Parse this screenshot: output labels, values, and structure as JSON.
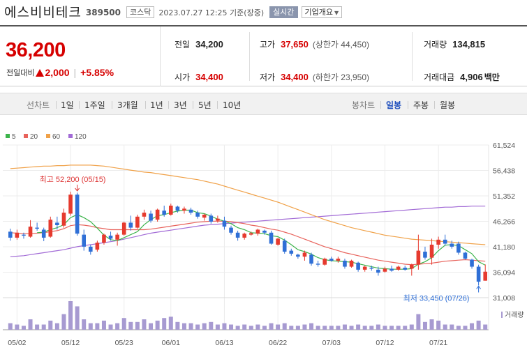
{
  "header": {
    "stock_name": "에스비비테크",
    "stock_code": "389500",
    "market": "코스닥",
    "timestamp": "2023.07.27 12:25 기준(장중)",
    "realtime_label": "실시간",
    "overview_label": "기업개요"
  },
  "summary": {
    "current_price": "36,200",
    "change_label": "전일대비",
    "change_amount": "2,000",
    "change_percent": "+5.85%",
    "prev_close_label": "전일",
    "prev_close": "34,200",
    "open_label": "시가",
    "open": "34,400",
    "high_label": "고가",
    "high": "37,650",
    "upper_limit": "(상한가 44,450)",
    "low_label": "저가",
    "low": "34,400",
    "lower_limit": "(하한가 23,950)",
    "volume_label": "거래량",
    "volume": "134,815",
    "amount_label": "거래대금",
    "amount": "4,906",
    "amount_unit": "백만"
  },
  "period_bar": {
    "label": "선차트",
    "periods": [
      "1일",
      "1주일",
      "3개월",
      "1년",
      "3년",
      "5년",
      "10년"
    ],
    "candle_label": "봉차트",
    "candles": [
      "일봉",
      "주봉",
      "월봉"
    ],
    "active_candle": "일봉"
  },
  "colors": {
    "up": "#e63a2e",
    "down": "#2f6fd6",
    "accent": "#1f4fbd",
    "volume": "#a79ad1"
  },
  "chart_data": {
    "type": "candlestick",
    "legend": [
      {
        "name": "5",
        "color": "#3cb44b"
      },
      {
        "name": "20",
        "color": "#e8625b"
      },
      {
        "name": "60",
        "color": "#f0a148"
      },
      {
        "name": "120",
        "color": "#a26bd6"
      }
    ],
    "y_ticks": [
      "61,524",
      "56,438",
      "51,352",
      "46,266",
      "41,180",
      "36,094",
      "31,008"
    ],
    "ylim": [
      31008,
      61524
    ],
    "x_ticks": [
      "05/02",
      "05/12",
      "05/23",
      "06/01",
      "06/13",
      "06/22",
      "07/03",
      "07/12",
      "07/21"
    ],
    "x_tick_index": [
      1,
      9,
      17,
      24,
      32,
      40,
      48,
      56,
      64
    ],
    "volume_label": "거래량",
    "annotations": {
      "max": {
        "text": "최고 52,200 (05/15)",
        "index": 10,
        "value": 52200
      },
      "min": {
        "text": "최저 33,450 (07/26)",
        "index": 70,
        "value": 33450
      }
    },
    "candles": [
      [
        44200,
        44800,
        42400,
        43000
      ],
      [
        43000,
        44600,
        42600,
        44000
      ],
      [
        43600,
        44000,
        42800,
        43400
      ],
      [
        43200,
        46500,
        43000,
        45200
      ],
      [
        45000,
        46000,
        44400,
        44800
      ],
      [
        44600,
        45000,
        42300,
        43000
      ],
      [
        43200,
        47200,
        43000,
        46600
      ],
      [
        46000,
        47200,
        44600,
        45500
      ],
      [
        45400,
        48800,
        45000,
        48000
      ],
      [
        47800,
        52200,
        47400,
        51600
      ],
      [
        51600,
        52000,
        43400,
        43800
      ],
      [
        43600,
        44600,
        40400,
        41200
      ],
      [
        41200,
        41600,
        39600,
        40200
      ],
      [
        40600,
        42400,
        40200,
        42000
      ],
      [
        42000,
        43800,
        41600,
        43600
      ],
      [
        43400,
        44200,
        42400,
        42800
      ],
      [
        42600,
        44000,
        41400,
        43600
      ],
      [
        43600,
        46200,
        43400,
        46000
      ],
      [
        46000,
        47400,
        44400,
        45000
      ],
      [
        45000,
        47600,
        44800,
        47200
      ],
      [
        47200,
        48600,
        46600,
        48000
      ],
      [
        47800,
        48400,
        46000,
        46400
      ],
      [
        46600,
        48800,
        46200,
        48600
      ],
      [
        48400,
        49400,
        47200,
        47600
      ],
      [
        47600,
        49800,
        47400,
        49400
      ],
      [
        49200,
        49400,
        48000,
        48400
      ],
      [
        48400,
        49200,
        47800,
        48800
      ],
      [
        48600,
        49000,
        47600,
        48000
      ],
      [
        48000,
        48400,
        46800,
        47200
      ],
      [
        47000,
        47800,
        46400,
        47600
      ],
      [
        47400,
        47800,
        45800,
        46200
      ],
      [
        46400,
        47400,
        46000,
        46800
      ],
      [
        46400,
        47200,
        44600,
        45200
      ],
      [
        45000,
        45400,
        43600,
        44000
      ],
      [
        44000,
        44400,
        42400,
        43000
      ],
      [
        43000,
        44000,
        42600,
        43800
      ],
      [
        43600,
        44200,
        43400,
        43900
      ],
      [
        43800,
        44800,
        43400,
        44600
      ],
      [
        44400,
        44600,
        43600,
        44000
      ],
      [
        44000,
        44400,
        41600,
        41800
      ],
      [
        41600,
        43000,
        41400,
        42800
      ],
      [
        42400,
        42800,
        39800,
        40200
      ],
      [
        40400,
        40800,
        39400,
        39800
      ],
      [
        39600,
        39800,
        38800,
        39200
      ],
      [
        39200,
        40400,
        38400,
        40000
      ],
      [
        39600,
        40000,
        37400,
        37800
      ],
      [
        37800,
        38400,
        37200,
        37600
      ],
      [
        37600,
        39000,
        37400,
        38800
      ],
      [
        38800,
        39200,
        38200,
        38400
      ],
      [
        38400,
        39200,
        38000,
        38800
      ],
      [
        38400,
        38800,
        36800,
        37200
      ],
      [
        37200,
        38600,
        37000,
        38400
      ],
      [
        38000,
        38200,
        36200,
        36600
      ],
      [
        36600,
        37400,
        36200,
        37200
      ],
      [
        37000,
        37400,
        36400,
        36800
      ],
      [
        36600,
        37200,
        35400,
        36000
      ],
      [
        36200,
        37200,
        36000,
        36800
      ],
      [
        36800,
        37400,
        36200,
        36400
      ],
      [
        36600,
        37400,
        36400,
        37200
      ],
      [
        37000,
        37400,
        36400,
        36600
      ],
      [
        36800,
        37800,
        35400,
        37600
      ],
      [
        37600,
        43600,
        36600,
        40400
      ],
      [
        40200,
        41200,
        38600,
        39000
      ],
      [
        39000,
        42800,
        37600,
        41600
      ],
      [
        41600,
        43200,
        40800,
        42600
      ],
      [
        42600,
        43600,
        41400,
        41800
      ],
      [
        41800,
        42400,
        40800,
        41200
      ],
      [
        41800,
        42200,
        39600,
        40000
      ],
      [
        40000,
        40200,
        38600,
        38800
      ],
      [
        38600,
        38800,
        36800,
        37200
      ],
      [
        37200,
        37600,
        33450,
        34200
      ],
      [
        34400,
        37650,
        34400,
        36200
      ]
    ],
    "volume": [
      5,
      4,
      3,
      8,
      4,
      4,
      7,
      5,
      12,
      22,
      18,
      8,
      5,
      5,
      7,
      4,
      5,
      9,
      6,
      6,
      8,
      5,
      7,
      9,
      10,
      6,
      5,
      5,
      4,
      5,
      6,
      4,
      5,
      4,
      3,
      4,
      3,
      4,
      3,
      5,
      4,
      5,
      3,
      3,
      4,
      5,
      3,
      3,
      3,
      3,
      4,
      3,
      4,
      3,
      3,
      4,
      3,
      3,
      3,
      3,
      4,
      12,
      6,
      8,
      7,
      4,
      4,
      3,
      3,
      5,
      7,
      4
    ],
    "ma5": [
      null,
      null,
      null,
      null,
      44000,
      44100,
      44600,
      45000,
      45600,
      47000,
      47600,
      47000,
      46200,
      44900,
      43500,
      42600,
      42400,
      43000,
      43600,
      44200,
      45600,
      46600,
      47400,
      47600,
      48000,
      48300,
      48500,
      48500,
      48000,
      47800,
      47300,
      46700,
      46300,
      45800,
      45000,
      44600,
      44000,
      43900,
      43800,
      43400,
      43200,
      42500,
      41600,
      40600,
      40200,
      39700,
      39000,
      38600,
      38400,
      38300,
      38200,
      38100,
      37800,
      37500,
      37200,
      36900,
      36800,
      36700,
      36700,
      36700,
      36800,
      37700,
      38200,
      39000,
      40400,
      41500,
      41600,
      41400,
      40600,
      39800,
      38200,
      37500
    ],
    "ma20": [
      44000,
      43900,
      43800,
      43800,
      43900,
      44000,
      44200,
      44400,
      44800,
      45400,
      45600,
      45500,
      45300,
      45000,
      44800,
      44600,
      44600,
      44600,
      44600,
      44600,
      44600,
      44700,
      44900,
      45100,
      45300,
      45500,
      45700,
      45900,
      46100,
      46200,
      46300,
      46300,
      46300,
      46200,
      46000,
      45800,
      45500,
      45300,
      45000,
      44700,
      44500,
      44100,
      43700,
      43200,
      42700,
      42200,
      41700,
      41200,
      40800,
      40400,
      40000,
      39700,
      39400,
      39100,
      38800,
      38500,
      38300,
      38100,
      37900,
      37700,
      37600,
      37700,
      37800,
      37900,
      38100,
      38300,
      38400,
      38500,
      38600,
      38500,
      38400,
      38300
    ],
    "ma60": [
      56800,
      56900,
      57000,
      57100,
      57200,
      57300,
      57300,
      57400,
      57400,
      57500,
      57500,
      57500,
      57500,
      57400,
      57300,
      57100,
      56900,
      56700,
      56500,
      56300,
      56100,
      56000,
      55800,
      55600,
      55400,
      55200,
      55000,
      54800,
      54600,
      54300,
      54000,
      53700,
      53300,
      52900,
      52500,
      52100,
      51700,
      51300,
      50900,
      50500,
      50100,
      49600,
      49100,
      48600,
      48100,
      47600,
      47100,
      46600,
      46200,
      45800,
      45400,
      45000,
      44700,
      44400,
      44100,
      43800,
      43500,
      43300,
      43100,
      42900,
      42700,
      42600,
      42500,
      42400,
      42300,
      42200,
      42100,
      42000,
      41900,
      41800,
      41700,
      41600
    ],
    "ma120": [
      39200,
      39300,
      39400,
      39600,
      39800,
      40000,
      40200,
      40400,
      40600,
      40900,
      41200,
      41400,
      41600,
      41800,
      42000,
      42200,
      42400,
      42700,
      43000,
      43300,
      43600,
      43900,
      44100,
      44300,
      44500,
      44700,
      44900,
      45100,
      45300,
      45500,
      45600,
      45700,
      45800,
      45900,
      46000,
      46100,
      46200,
      46300,
      46400,
      46500,
      46600,
      46700,
      46800,
      46900,
      47000,
      47100,
      47200,
      47300,
      47400,
      47500,
      47600,
      47700,
      47800,
      47900,
      48000,
      48100,
      48200,
      48300,
      48400,
      48500,
      48600,
      48700,
      48800,
      48900,
      49000,
      49100,
      49100,
      49200,
      49200,
      49300,
      49300,
      49300
    ]
  }
}
